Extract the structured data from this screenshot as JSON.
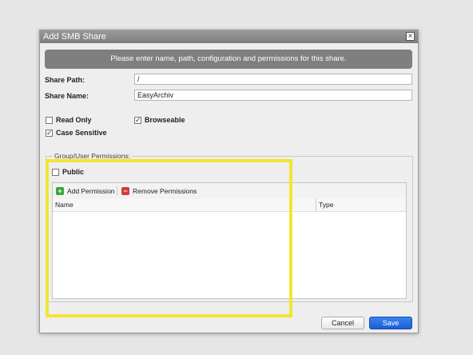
{
  "dialog": {
    "title": "Add SMB Share",
    "close_symbol": "×",
    "banner": "Please enter name, path, configuration and permissions for this share."
  },
  "form": {
    "share_path_label": "Share Path:",
    "share_path_value": "/",
    "share_name_label": "Share Name:",
    "share_name_value": "EasyArchiv"
  },
  "options": {
    "read_only": {
      "label": "Read Only",
      "checked": false
    },
    "browseable": {
      "label": "Browseable",
      "checked": true
    },
    "case_sensitive": {
      "label": "Case Sensitive",
      "checked": true
    }
  },
  "permissions": {
    "legend": "Group/User Permissions:",
    "public": {
      "label": "Public",
      "checked": false
    },
    "add_label": "Add Permission",
    "remove_label": "Remove Permissions",
    "columns": [
      "Name",
      "Type"
    ],
    "rows": []
  },
  "buttons": {
    "cancel": "Cancel",
    "save": "Save"
  },
  "icons": {
    "add": "plus-icon",
    "remove": "minus-icon",
    "check": "checkmark-icon"
  },
  "colors": {
    "highlight": "#f2e531",
    "save_button": "#1a5fd1",
    "add_icon": "#3ea33e",
    "remove_icon": "#d33b3b"
  }
}
